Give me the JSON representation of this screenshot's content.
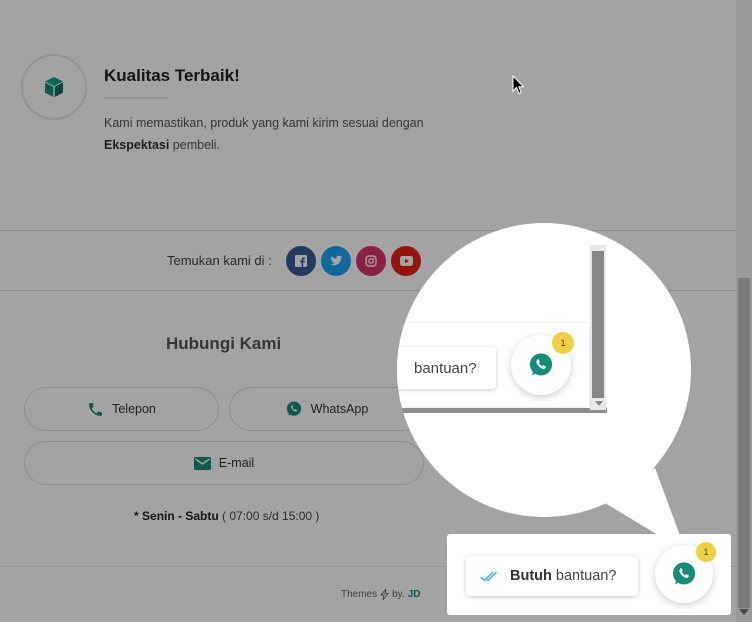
{
  "feature": {
    "title": "Kualitas Terbaik!",
    "text_before": "Kami memastikan, produk yang kami kirim sesuai dengan ",
    "text_bold": "Ekspektasi",
    "text_after": " pembeli.",
    "icon": "box-icon"
  },
  "social": {
    "label": "Temukan kami di :",
    "items": [
      {
        "name": "facebook",
        "icon": "facebook-icon",
        "color": "#3b5998"
      },
      {
        "name": "twitter",
        "icon": "twitter-icon",
        "color": "#1da1f2"
      },
      {
        "name": "instagram",
        "icon": "instagram-icon",
        "color": "#e1306c"
      },
      {
        "name": "youtube",
        "icon": "youtube-icon",
        "color": "#e62117"
      }
    ]
  },
  "contact": {
    "title": "Hubungi Kami",
    "phone_label": "Telepon",
    "whatsapp_label": "WhatsApp",
    "email_label": "E-mail",
    "hours_prefix": "* ",
    "hours_days": "Senin - Sabtu",
    "hours_time": " ( 07:00 s/d 15:00 )"
  },
  "footer": {
    "themes": "Themes",
    "by": "by.",
    "author": "JD"
  },
  "chat_widget": {
    "bold": "Butuh",
    "rest": " bantuan?",
    "badge": "1",
    "magnified_text": "bantuan?",
    "magnified_badge": "1"
  },
  "colors": {
    "accent": "#168c79",
    "badge": "#f1cf45",
    "whatsapp": "#168c79"
  }
}
